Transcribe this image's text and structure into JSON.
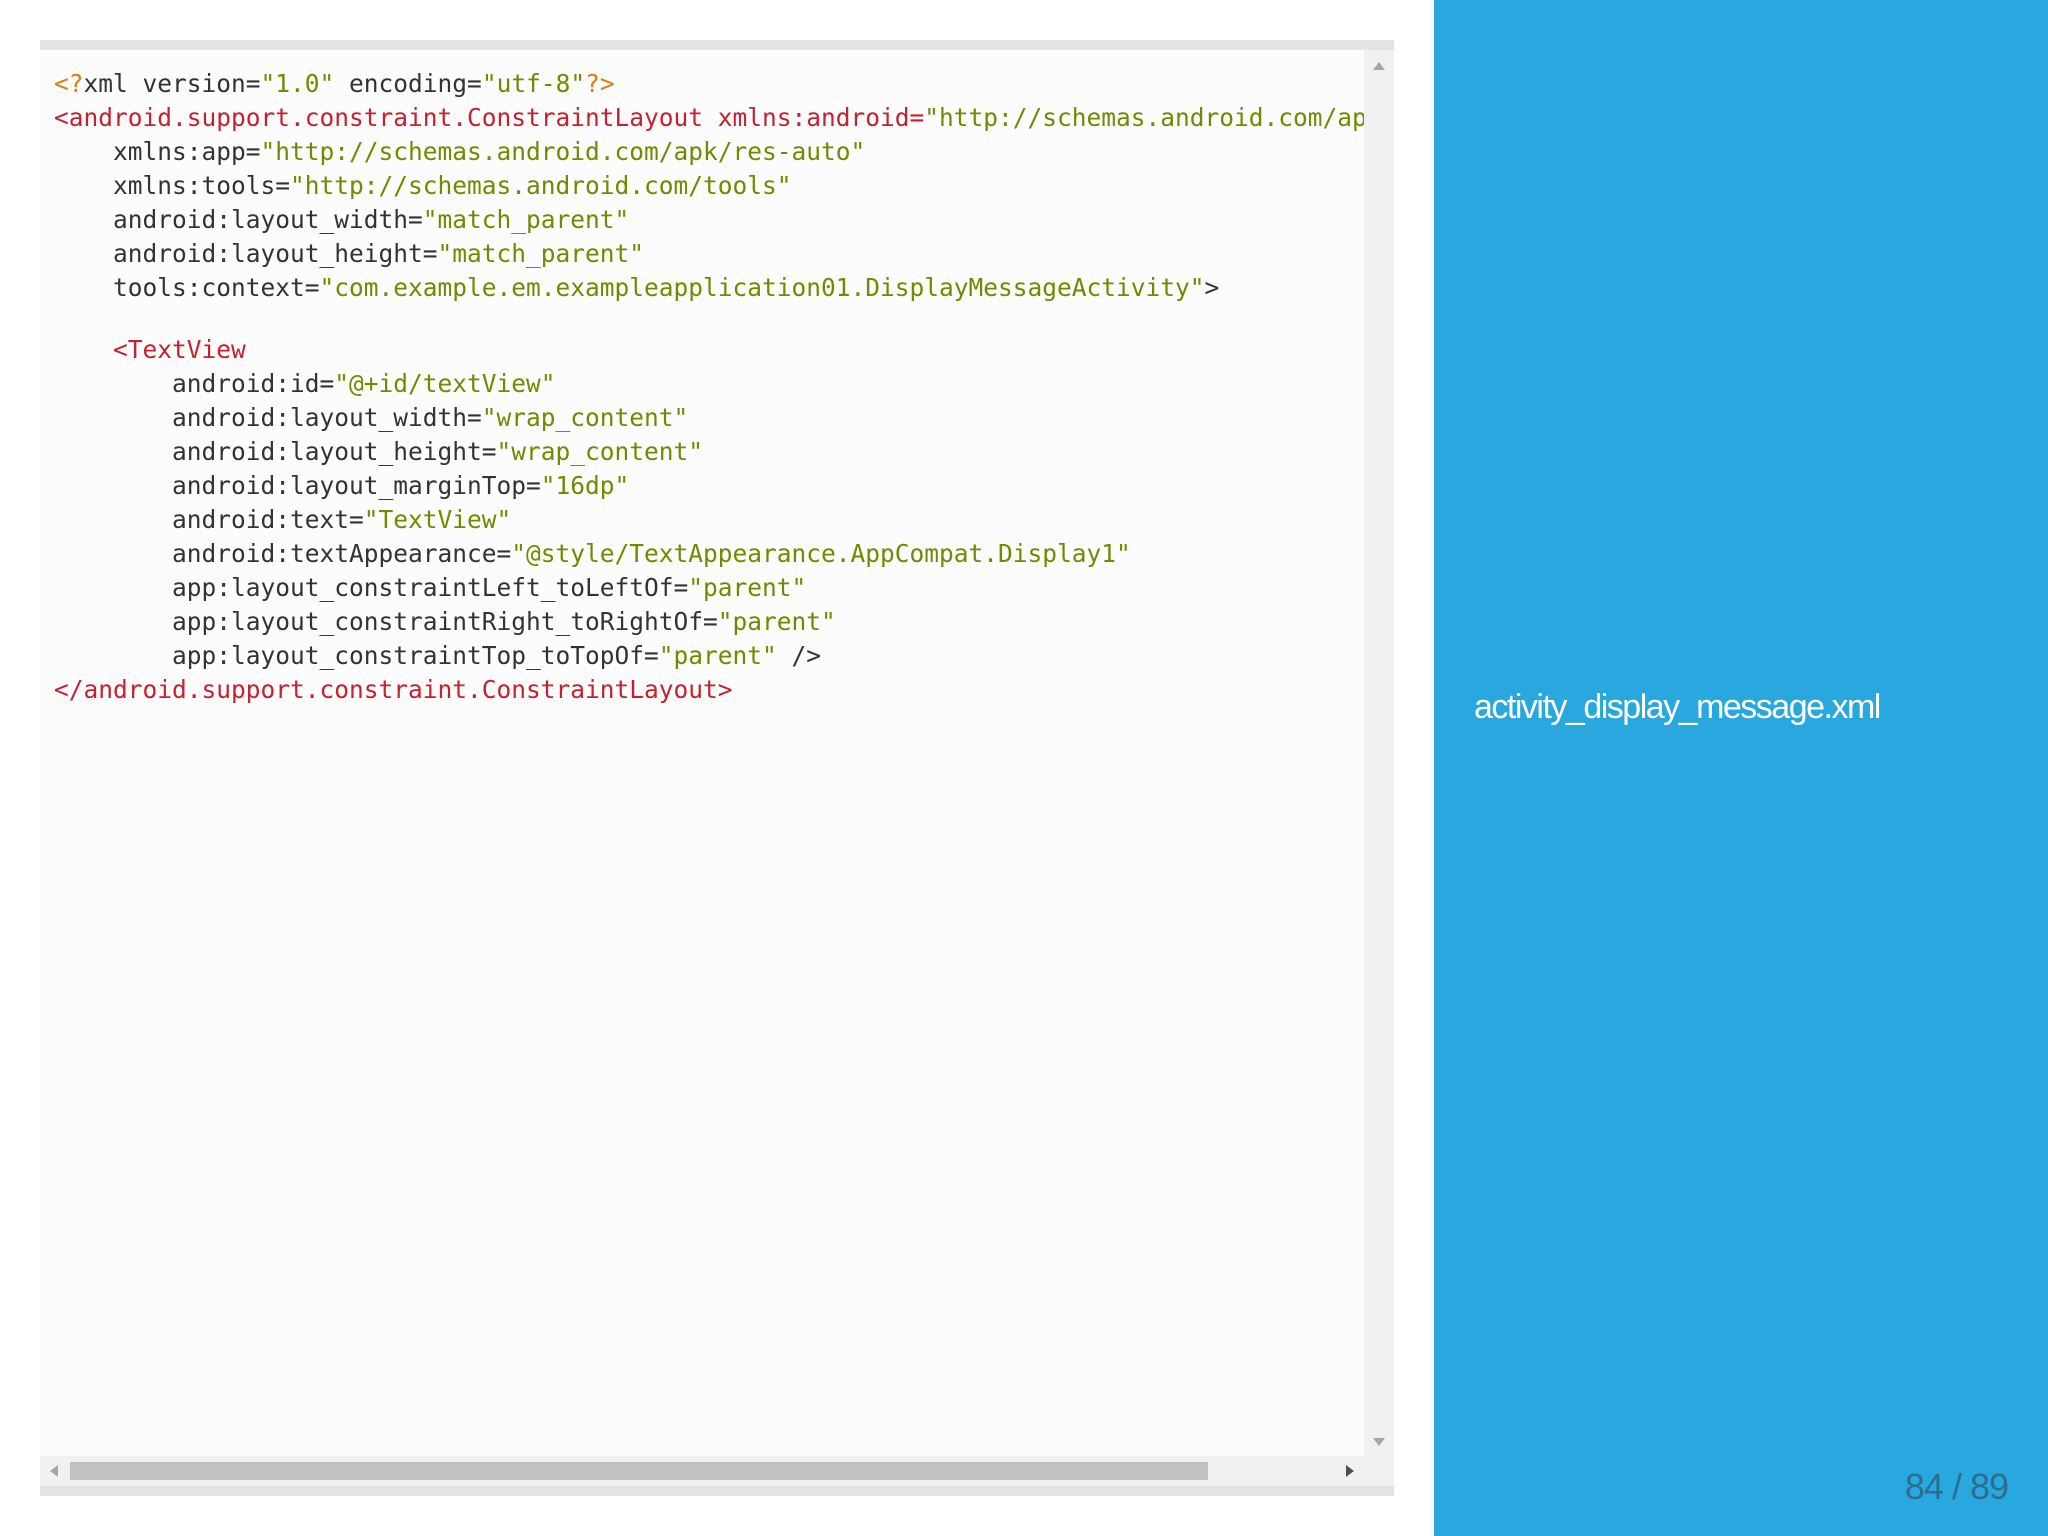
{
  "code": {
    "lines": [
      [
        {
          "t": "pi",
          "s": "<?"
        },
        {
          "t": "attr",
          "s": "xml version="
        },
        {
          "t": "str",
          "s": "\"1.0\""
        },
        {
          "t": "attr",
          "s": " encoding="
        },
        {
          "t": "str",
          "s": "\"utf-8\""
        },
        {
          "t": "pi",
          "s": "?>"
        }
      ],
      [
        {
          "t": "tag",
          "s": "<android.support.constraint.ConstraintLayout xmlns:android="
        },
        {
          "t": "str",
          "s": "\"http://schemas.android.com/apk/res/android\""
        }
      ],
      [
        {
          "t": "attr",
          "s": "    xmlns:app="
        },
        {
          "t": "str",
          "s": "\"http://schemas.android.com/apk/res-auto\""
        }
      ],
      [
        {
          "t": "attr",
          "s": "    xmlns:tools="
        },
        {
          "t": "str",
          "s": "\"http://schemas.android.com/tools\""
        }
      ],
      [
        {
          "t": "attr",
          "s": "    android:layout_width="
        },
        {
          "t": "str",
          "s": "\"match_parent\""
        }
      ],
      [
        {
          "t": "attr",
          "s": "    android:layout_height="
        },
        {
          "t": "str",
          "s": "\"match_parent\""
        }
      ],
      [
        {
          "t": "attr",
          "s": "    tools:context="
        },
        {
          "t": "str",
          "s": "\"com.example.em.exampleapplication01.DisplayMessageActivity\""
        },
        {
          "t": "attr",
          "s": ">"
        }
      ],
      [],
      [
        {
          "t": "tag",
          "s": "    <TextView"
        }
      ],
      [
        {
          "t": "attr",
          "s": "        android:id="
        },
        {
          "t": "str",
          "s": "\"@+id/textView\""
        }
      ],
      [
        {
          "t": "attr",
          "s": "        android:layout_width="
        },
        {
          "t": "str",
          "s": "\"wrap_content\""
        }
      ],
      [
        {
          "t": "attr",
          "s": "        android:layout_height="
        },
        {
          "t": "str",
          "s": "\"wrap_content\""
        }
      ],
      [
        {
          "t": "attr",
          "s": "        android:layout_marginTop="
        },
        {
          "t": "str",
          "s": "\"16dp\""
        }
      ],
      [
        {
          "t": "attr",
          "s": "        android:text="
        },
        {
          "t": "str",
          "s": "\"TextView\""
        }
      ],
      [
        {
          "t": "attr",
          "s": "        android:textAppearance="
        },
        {
          "t": "str",
          "s": "\"@style/TextAppearance.AppCompat.Display1\""
        }
      ],
      [
        {
          "t": "attr",
          "s": "        app:layout_constraintLeft_toLeftOf="
        },
        {
          "t": "str",
          "s": "\"parent\""
        }
      ],
      [
        {
          "t": "attr",
          "s": "        app:layout_constraintRight_toRightOf="
        },
        {
          "t": "str",
          "s": "\"parent\""
        }
      ],
      [
        {
          "t": "attr",
          "s": "        app:layout_constraintTop_toTopOf="
        },
        {
          "t": "str",
          "s": "\"parent\""
        },
        {
          "t": "attr",
          "s": " />"
        }
      ],
      [
        {
          "t": "tag",
          "s": "</android.support.constraint.ConstraintLayout>"
        }
      ]
    ]
  },
  "horizontal_scroll_fraction_visible": 0.9,
  "caption": "activity_display_message.xml",
  "page_indicator": "84 / 89",
  "colors": {
    "sidebar": "#29a7df",
    "tag": "#c6212e",
    "string": "#6f8b00",
    "processing_instruction": "#e07b11",
    "text": "#333333"
  }
}
